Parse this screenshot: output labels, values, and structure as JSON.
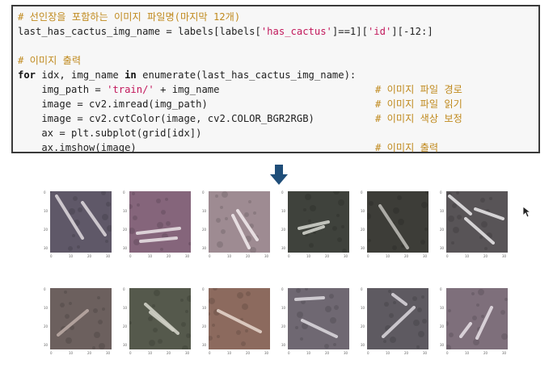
{
  "code": {
    "l1": "# 선인장을 포함하는 이미지 파일명(마지막 12개)",
    "l2a": "last_has_cactus_img_name = labels[labels[",
    "l2b": "'has_cactus'",
    "l2c": "]==1][",
    "l2d": "'id'",
    "l2e": "][-12:]",
    "l4": "# 이미지 출력",
    "l5a": "for",
    "l5b": " idx, img_name ",
    "l5c": "in",
    "l5d": " enumerate(last_has_cactus_img_name):",
    "l6a": "    img_path = ",
    "l6b": "'train/'",
    "l6c": " + img_name",
    "l6d": "# 이미지 파일 경로",
    "l7a": "    image = cv2.imread(img_path)",
    "l7b": "# 이미지 파일 읽기",
    "l8a": "    image = cv2.cvtColor(image, cv2.COLOR_BGR2RGB)",
    "l8b": "# 이미지 색상 보정",
    "l9a": "    ax = plt.subplot(grid[idx])",
    "l10a": "    ax.imshow(image)",
    "l10b": "# 이미지 출력"
  },
  "ticks": {
    "y": [
      "0",
      "10",
      "20",
      "30"
    ],
    "x": [
      "0",
      "10",
      "20",
      "30"
    ]
  },
  "thumbnails": [
    {
      "bg": "#5f5868",
      "stroke": "#d9d4d8"
    },
    {
      "bg": "#85657b",
      "stroke": "#e6dde2"
    },
    {
      "bg": "#9e8b92",
      "stroke": "#efe8ea"
    },
    {
      "bg": "#3f423c",
      "stroke": "#cfd0c9"
    },
    {
      "bg": "#3d3d38",
      "stroke": "#b9b8b2"
    },
    {
      "bg": "#585457",
      "stroke": "#e4e2e4"
    },
    {
      "bg": "#6c605e",
      "stroke": "#b9a9a3"
    },
    {
      "bg": "#55594c",
      "stroke": "#d1d1c6"
    },
    {
      "bg": "#8c6a5e",
      "stroke": "#e3d3c9"
    },
    {
      "bg": "#6f6872",
      "stroke": "#d9d5db"
    },
    {
      "bg": "#5e5a61",
      "stroke": "#d6d2d8"
    },
    {
      "bg": "#7e6f7b",
      "stroke": "#e2dbe1"
    }
  ],
  "colors": {
    "comment": "#c08a1e",
    "string": "#c2185b",
    "arrow": "#1f4e79"
  }
}
